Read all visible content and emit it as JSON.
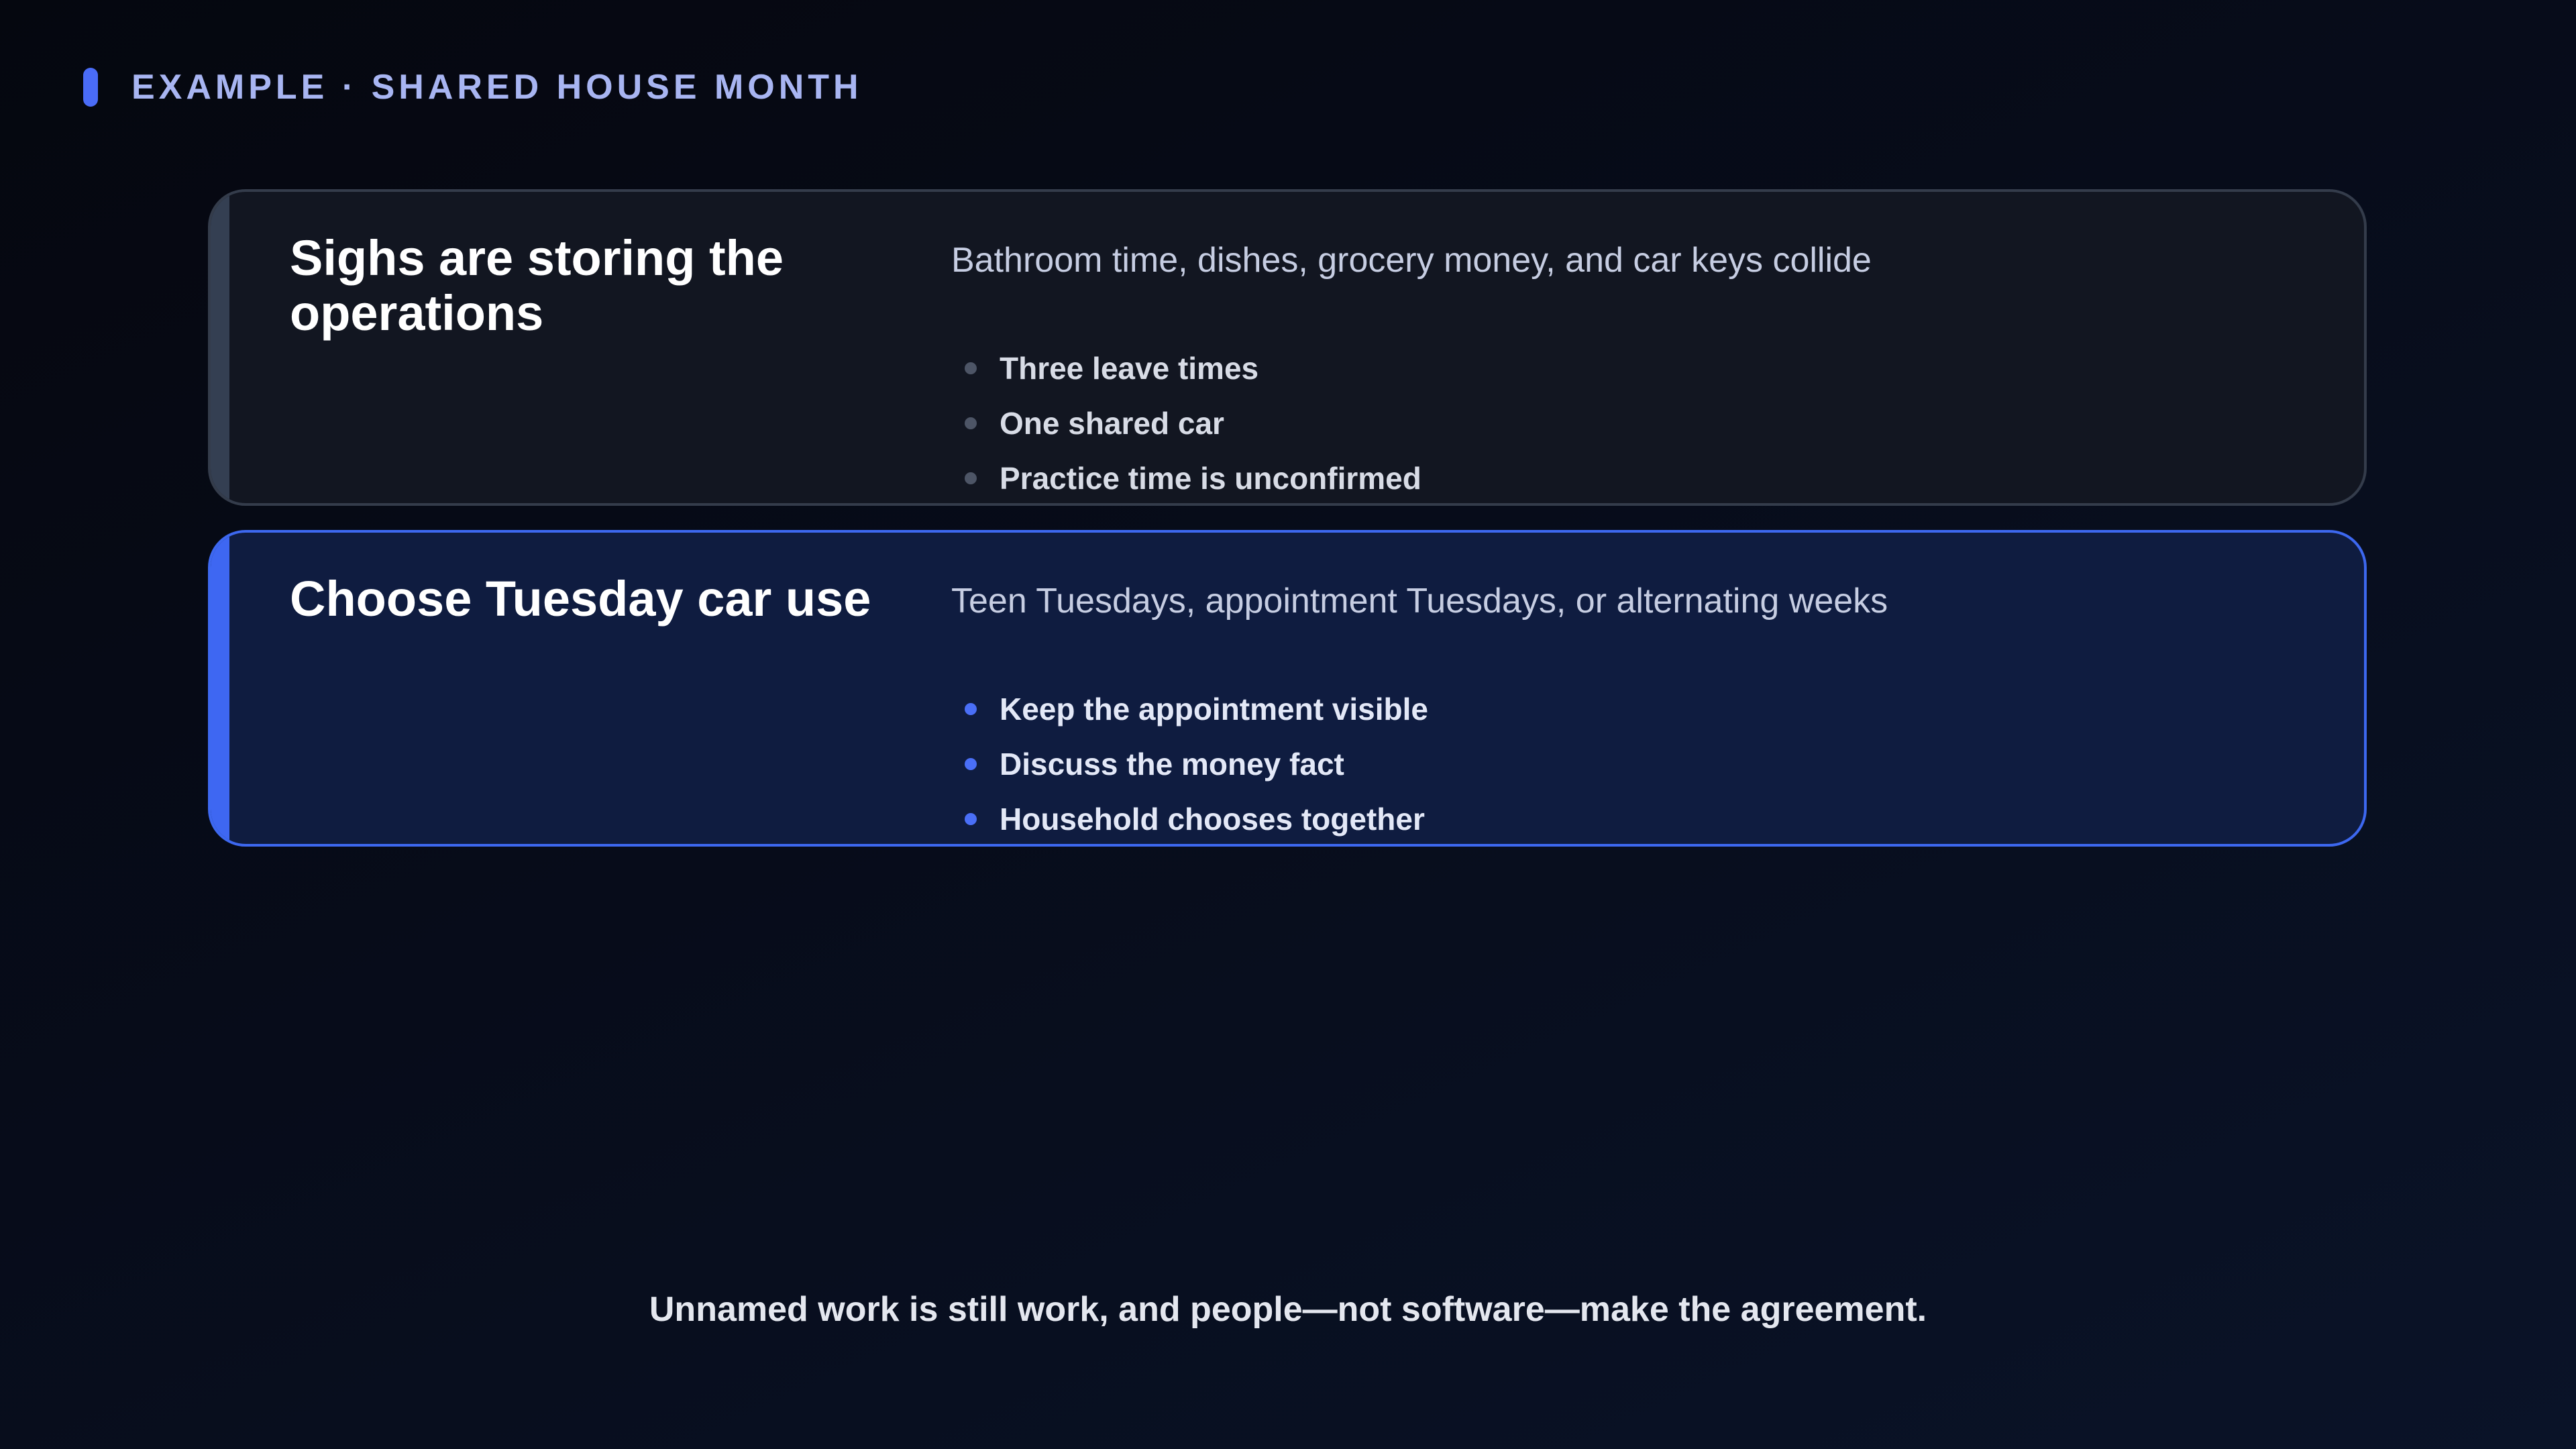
{
  "header": {
    "eyebrow": "EXAMPLE · SHARED HOUSE MONTH"
  },
  "cards": [
    {
      "title": "Sighs are storing the operations",
      "description": "Bathroom time, dishes, grocery money, and car keys collide",
      "bullets": [
        "Three leave times",
        "One shared car",
        "Practice time is unconfirmed"
      ]
    },
    {
      "title": "Choose Tuesday car use",
      "description": "Teen Tuesdays, appointment Tuesdays, or alternating weeks",
      "bullets": [
        "Keep the appointment visible",
        "Discuss the money fact",
        "Household chooses together"
      ]
    }
  ],
  "footer": {
    "text": "Unnamed work is still work, and people—not software—make the agreement."
  },
  "colors": {
    "accent": "#4a6cf7",
    "card_muted_border": "#343c4b",
    "card_active_border": "#3d68f0"
  }
}
